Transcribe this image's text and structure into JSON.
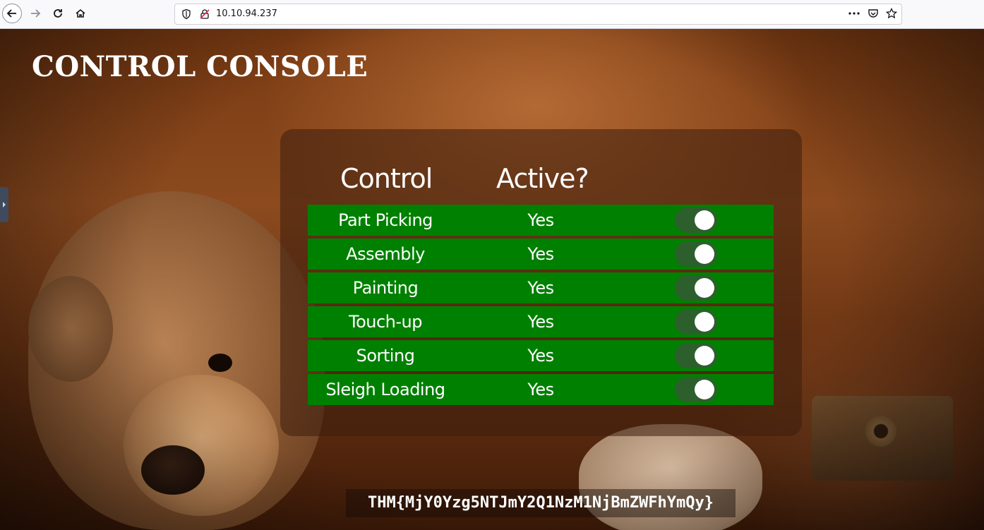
{
  "browser": {
    "url": "10.10.94.237",
    "icons": {
      "back": "arrow-left-icon",
      "forward": "arrow-right-icon",
      "reload": "reload-icon",
      "home": "home-icon",
      "shield": "shield-icon",
      "insecure": "insecure-lock-icon",
      "more": "more-icon",
      "pocket": "pocket-icon",
      "bookmark": "star-icon"
    }
  },
  "page": {
    "title": "CONTROL CONSOLE",
    "columns": {
      "control": "Control",
      "active": "Active?"
    },
    "rows": [
      {
        "name": "Part Picking",
        "active": "Yes",
        "toggle_on": true
      },
      {
        "name": "Assembly",
        "active": "Yes",
        "toggle_on": true
      },
      {
        "name": "Painting",
        "active": "Yes",
        "toggle_on": true
      },
      {
        "name": "Touch-up",
        "active": "Yes",
        "toggle_on": true
      },
      {
        "name": "Sorting",
        "active": "Yes",
        "toggle_on": true
      },
      {
        "name": "Sleigh Loading",
        "active": "Yes",
        "toggle_on": true
      }
    ],
    "flag": "THM{MjY0Yzg5NTJmY2Q1NzM1NjBmZWFhYmQy}",
    "colors": {
      "row_bg": "#008000",
      "toggle_track": "#2d5f2d",
      "text": "#ffffff"
    }
  }
}
